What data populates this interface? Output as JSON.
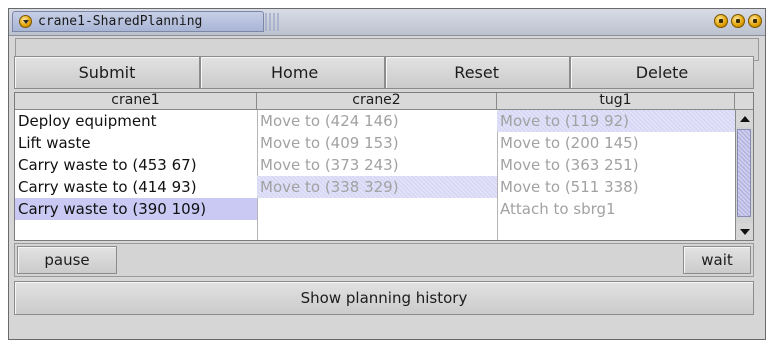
{
  "window": {
    "title": "crane1-SharedPlanning",
    "menu_icon": "window-menu-icon",
    "controls": [
      "minimize-icon",
      "maximize-icon",
      "close-icon"
    ]
  },
  "toolbar": {
    "submit_label": "Submit",
    "home_label": "Home",
    "reset_label": "Reset",
    "delete_label": "Delete"
  },
  "table": {
    "columns": [
      {
        "header": "crane1",
        "rows": [
          "Deploy equipment",
          "Lift waste",
          "Carry waste to (453 67)",
          "Carry waste to (414 93)",
          "Carry waste to (390 109)"
        ]
      },
      {
        "header": "crane2",
        "rows": [
          "Move to (424 146)",
          "Move to (409 153)",
          "Move to (373 243)",
          "Move to (338 329)",
          ""
        ]
      },
      {
        "header": "tug1",
        "rows": [
          "Move to (119 92)",
          "Move to (200 145)",
          "Move to (363 251)",
          "Move to (511 338)",
          "Attach to sbrg1"
        ]
      }
    ],
    "scrollbar": {
      "up_icon": "arrow-up-icon",
      "down_icon": "arrow-down-icon"
    }
  },
  "controls": {
    "pause_label": "pause",
    "wait_label": "wait",
    "history_label": "Show planning history"
  },
  "colors": {
    "selection": "#c9c9f4",
    "disabled_text": "#a2a2a2",
    "title_accent": "#a9b5d6",
    "button_face": "#d6d6d6"
  }
}
